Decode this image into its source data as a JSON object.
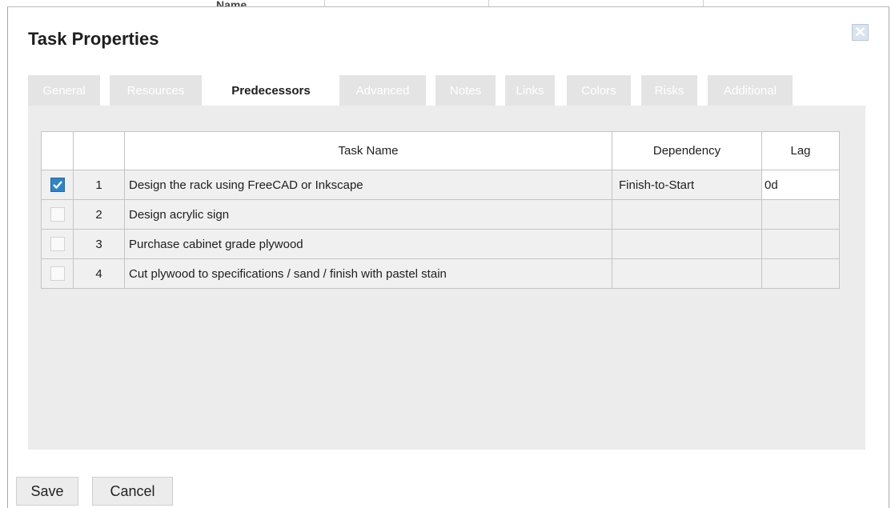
{
  "background": {
    "header_text": "Name"
  },
  "dialog": {
    "title": "Task Properties",
    "close_icon": "close-icon"
  },
  "tabs": [
    {
      "label": "General",
      "active": false
    },
    {
      "label": "Resources",
      "active": false
    },
    {
      "label": "Predecessors",
      "active": true
    },
    {
      "label": "Advanced",
      "active": false
    },
    {
      "label": "Notes",
      "active": false
    },
    {
      "label": "Links",
      "active": false
    },
    {
      "label": "Colors",
      "active": false
    },
    {
      "label": "Risks",
      "active": false
    },
    {
      "label": "Additional",
      "active": false
    }
  ],
  "grid": {
    "columns": [
      "",
      "",
      "Task Name",
      "Dependency",
      "Lag"
    ],
    "rows": [
      {
        "checked": true,
        "num": "1",
        "name": "Design the rack using FreeCAD or Inkscape",
        "dependency": "Finish-to-Start",
        "lag": "0d"
      },
      {
        "checked": false,
        "num": "2",
        "name": "Design acrylic sign",
        "dependency": "",
        "lag": ""
      },
      {
        "checked": false,
        "num": "3",
        "name": "Purchase cabinet grade plywood",
        "dependency": "",
        "lag": ""
      },
      {
        "checked": false,
        "num": "4",
        "name": "Cut plywood to specifications / sand / finish with pastel stain",
        "dependency": "",
        "lag": ""
      }
    ]
  },
  "footer": {
    "save_label": "Save",
    "cancel_label": "Cancel"
  },
  "colors": {
    "accent": "#2f84c6",
    "inactive_tab": "#e4e4e4",
    "panel": "#ececec"
  }
}
